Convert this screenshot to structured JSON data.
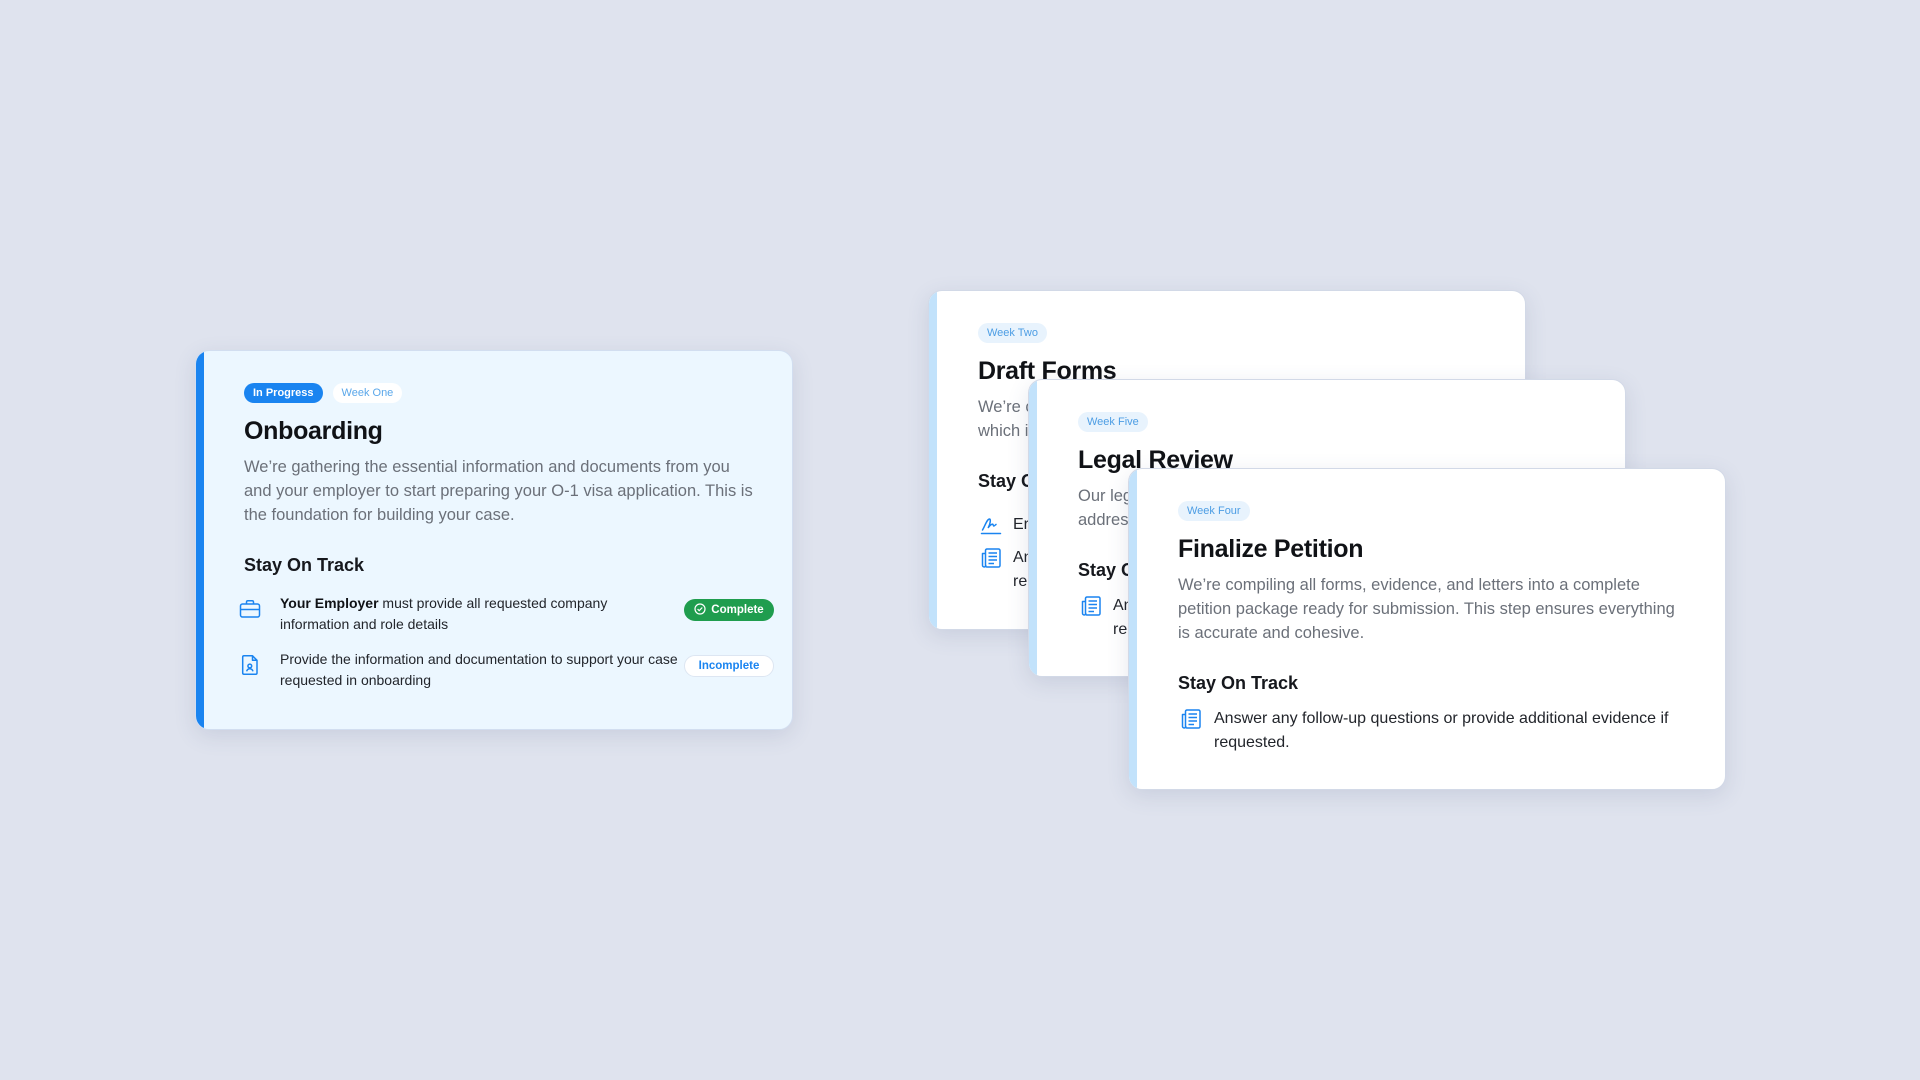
{
  "colors": {
    "accent": "#1a84f0",
    "complete": "#1f9d4e",
    "pending_bar": "#c2e2fb",
    "active_card_bg": "#ecf7ff",
    "page_bg": "#dfe3ee"
  },
  "cards": {
    "onboarding": {
      "status_badge": "In Progress",
      "week": "Week One",
      "title": "Onboarding",
      "description": "We’re gathering the essential information and documents from you and your employer to start preparing your O-1 visa application. This is the foundation for building your case.",
      "section_title": "Stay On Track",
      "tasks": [
        {
          "icon": "briefcase-icon",
          "strong": "Your Employer",
          "text": " must provide all requested company information and role details",
          "status": "Complete"
        },
        {
          "icon": "document-user-icon",
          "text": "Provide the information and documentation to support your case requested in onboarding",
          "status": "Incomplete"
        }
      ]
    },
    "draft_forms": {
      "week": "Week Two",
      "title": "Draft Forms",
      "description": "We’re c which i",
      "section_title": "Stay O",
      "tasks": [
        {
          "icon": "signature-icon",
          "text": "Er"
        },
        {
          "icon": "newspaper-icon",
          "text": "An re"
        }
      ]
    },
    "legal_review": {
      "week": "Week Five",
      "title": "Legal Review",
      "description": "Our leg addres",
      "section_title": "Stay O",
      "tasks": [
        {
          "icon": "newspaper-icon",
          "text": "An re"
        }
      ]
    },
    "finalize_petition": {
      "week": "Week Four",
      "title": "Finalize Petition",
      "description": "We’re compiling all forms, evidence, and letters into a complete petition package ready for submission. This step ensures everything is accurate and cohesive.",
      "section_title": "Stay On Track",
      "tasks": [
        {
          "icon": "newspaper-icon",
          "text": "Answer any follow-up questions or provide additional evidence if requested."
        }
      ]
    }
  }
}
